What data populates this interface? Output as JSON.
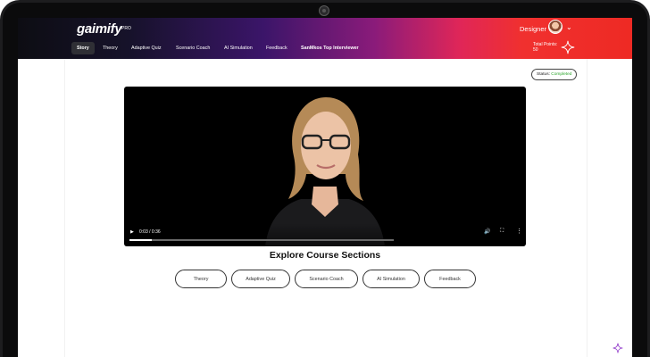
{
  "app": {
    "brand": "gaimify",
    "brand_sup": "PRO",
    "role": "Designer"
  },
  "nav": {
    "items": [
      {
        "label": "Story",
        "active": true
      },
      {
        "label": "Theory"
      },
      {
        "label": "Adaptive Quiz"
      },
      {
        "label": "Scenario Coach"
      },
      {
        "label": "AI Simulation"
      },
      {
        "label": "Feedback"
      },
      {
        "label": "SanMkos Top Interviewer"
      }
    ],
    "points_label": "Total Points:",
    "points_value": "50"
  },
  "status": {
    "label": "Status:",
    "value": "Completed",
    "value_color": "#2aa52a"
  },
  "video": {
    "time": "0:03 / 0:36",
    "progress": 0.083
  },
  "sections": {
    "title": "Explore Course Sections",
    "buttons": [
      "Theory",
      "Adaptive Quiz",
      "Scenario Coach",
      "AI Simulation",
      "Feedback"
    ]
  },
  "icons": {
    "play": "play-icon",
    "volume": "volume-icon",
    "fullscreen": "fullscreen-icon",
    "more": "more-vertical-icon",
    "sparkle": "sparkle-icon",
    "chevron": "chevron-down-icon"
  },
  "colors": {
    "accent_start": "#3b1569",
    "accent_end": "#ee2a24",
    "status_green": "#2aa52a"
  }
}
